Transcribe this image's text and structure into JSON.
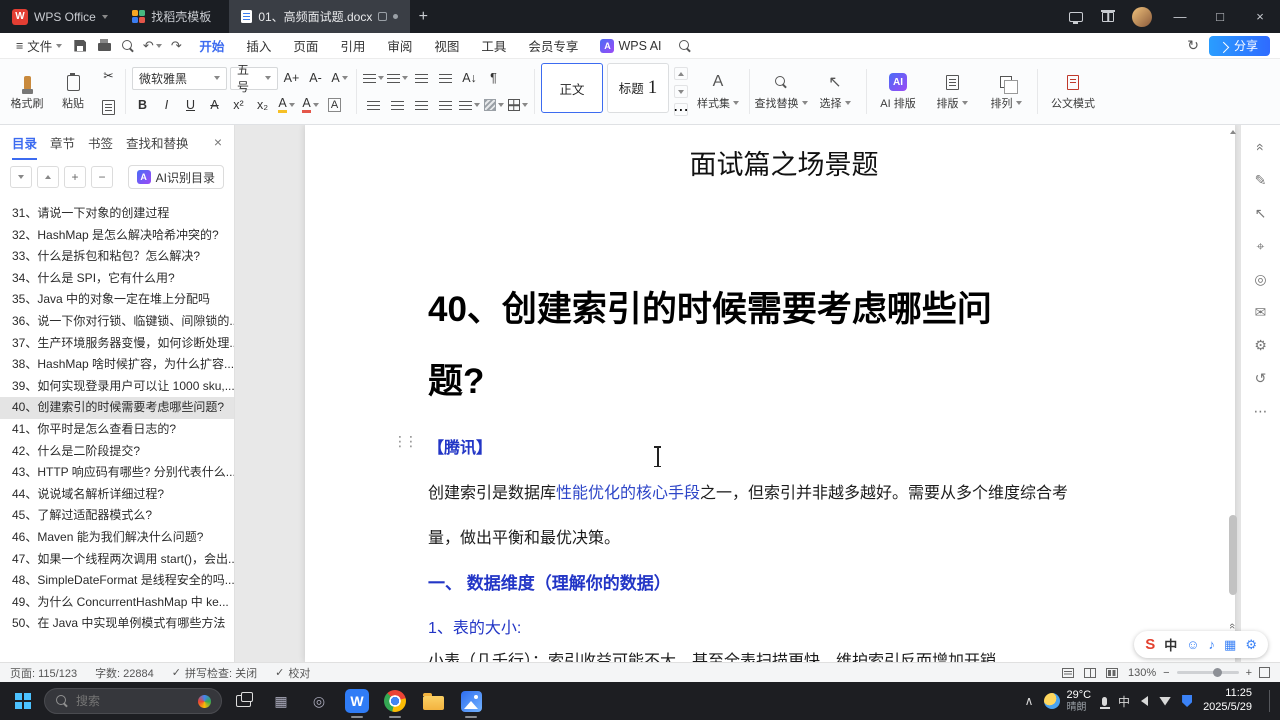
{
  "colors": {
    "accent_blue": "#3c6bf0",
    "share_button_blue": "#2f6bff",
    "doc_heading_blue": "#2336c6",
    "doc_link_blue": "#2e46c8",
    "toc_selected_bg": "#e4e4e4",
    "titlebar_bg": "#1b1e23",
    "taskbar_bg": "#1d1e22"
  },
  "icons": {
    "hamburger": "≡",
    "plus": "+",
    "minus": "−",
    "minimize": "—",
    "maximize": "□",
    "close": "×",
    "undo": "↶",
    "redo": "↷",
    "scissors": "✂",
    "paragraph_mark": "¶",
    "letter_a": "A",
    "pen": "✎",
    "cursor_arrow": "↖",
    "target": "⌖",
    "circle": "◎",
    "mail": "✉",
    "gear": "⚙",
    "history": "↺",
    "more": "⋯",
    "drag_handle": "⋮⋮",
    "double_chevron": "«",
    "chevron_up": "∧",
    "check": "✓",
    "sync": "↻",
    "smiley": "☺",
    "mic_note": "♪",
    "keyboard": "▦",
    "sort_az": "A↓",
    "wps_w": "W",
    "ai": "AI"
  },
  "titlebar": {
    "app_tab_label": "WPS Office",
    "template_tab_label": "找稻壳模板",
    "doc_tab_label": "01、高频面试题.docx"
  },
  "menubar": {
    "file_label": "文件",
    "items": [
      "开始",
      "插入",
      "页面",
      "引用",
      "审阅",
      "视图",
      "工具",
      "会员专享",
      "WPS AI"
    ],
    "share_label": "分享"
  },
  "ribbon": {
    "format_painter_label": "格式刷",
    "paste_label": "粘贴",
    "font_family": "微软雅黑",
    "font_size": "五号",
    "font_bigger": "A+",
    "font_smaller": "A-",
    "bold": "B",
    "italic": "I",
    "underline": "U",
    "superscript": "x²",
    "subscript": "x₂",
    "style_body_label": "正文",
    "style_heading_prefix": "标题",
    "style_heading_number": "1",
    "style_set_label": "样式集",
    "find_replace_label": "查找替换",
    "select_label": "选择",
    "ai_layout_label": "AI 排版",
    "layout_label": "排版",
    "arrange_label": "排列",
    "doc_mode_label": "公文模式"
  },
  "sidebar": {
    "tabs": [
      "目录",
      "章节",
      "书签",
      "查找和替换"
    ],
    "ai_recognize_label": "AI识别目录",
    "items": [
      {
        "label": "31、请说一下对象的创建过程",
        "selected": false
      },
      {
        "label": "32、HashMap 是怎么解决哈希冲突的?",
        "selected": false
      },
      {
        "label": "33、什么是拆包和粘包？怎么解决?",
        "selected": false
      },
      {
        "label": "34、什么是 SPI，它有什么用?",
        "selected": false
      },
      {
        "label": "35、Java 中的对象一定在堆上分配吗",
        "selected": false
      },
      {
        "label": "36、说一下你对行锁、临键锁、间隙锁的...",
        "selected": false
      },
      {
        "label": "37、生产环境服务器变慢，如何诊断处理...",
        "selected": false
      },
      {
        "label": "38、HashMap 啥时候扩容，为什么扩容...",
        "selected": false
      },
      {
        "label": "39、如何实现登录用户可以让 1000 sku,...",
        "selected": false
      },
      {
        "label": "40、创建索引的时候需要考虑哪些问题?",
        "selected": true
      },
      {
        "label": "41、你平时是怎么查看日志的?",
        "selected": false
      },
      {
        "label": "42、什么是二阶段提交?",
        "selected": false
      },
      {
        "label": "43、HTTP 响应码有哪些? 分别代表什么...",
        "selected": false
      },
      {
        "label": "44、说说域名解析详细过程?",
        "selected": false
      },
      {
        "label": "45、了解过适配器模式么?",
        "selected": false
      },
      {
        "label": "46、Maven 能为我们解决什么问题?",
        "selected": false
      },
      {
        "label": "47、如果一个线程两次调用 start()，会出...",
        "selected": false
      },
      {
        "label": "48、SimpleDateFormat 是线程安全的吗...",
        "selected": false
      },
      {
        "label": "49、为什么 ConcurrentHashMap 中 ke...",
        "selected": false
      },
      {
        "label": "50、在 Java 中实现单例模式有哪些方法",
        "selected": false
      }
    ]
  },
  "document": {
    "page_title": "面试篇之场景题",
    "heading_line1": "40、创建索引的时候需要考虑哪些问",
    "heading_line2": "题?",
    "company_tag": "【腾讯】",
    "para1_before_link": "创建索引是数据库",
    "para1_link": "性能优化的核心手段",
    "para1_after_link": "之一，但索引并非越多越好。需要从多个维度综合考",
    "para1_line2": "量，做出平衡和最优决策。",
    "section_heading": "一、 数据维度（理解你的数据）",
    "sub_heading": "1、表的大小:",
    "clipped_line": "小表（几千行）：索引收益可能不大，甚至全表扫描更快，维护索引反而增加开销"
  },
  "statusbar": {
    "page_info": "页面: 115/123",
    "word_count": "字数: 22884",
    "spellcheck": "拼写检查: 关闭",
    "proofread": "校对",
    "zoom_level": "130%"
  },
  "taskbar": {
    "search_placeholder": "搜索",
    "weather_temp": "29°C",
    "weather_desc": "晴朗",
    "time": "11:25",
    "date": "2025/5/29",
    "ime_mode": "中",
    "sogou": "S"
  }
}
